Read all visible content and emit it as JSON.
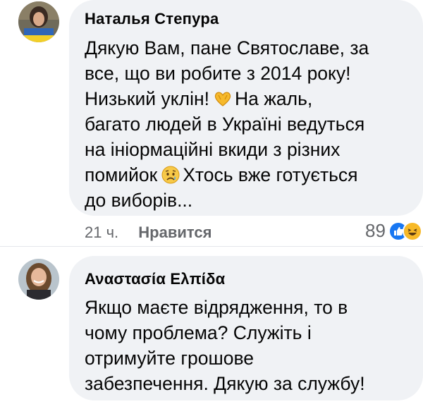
{
  "comments": [
    {
      "author": "Наталья Степура",
      "lines": [
        "Дякую Вам, пане Святославе, за",
        "все, що ви робите з 2014 року!",
        "Низький уклін!",
        "На жаль,",
        "багато людей в Україні ведуться",
        "на ініормаційні вкиди з різних",
        "помийок",
        "Хтось вже готується",
        "до виборів..."
      ],
      "emojis": [
        "heart-hands",
        "sad-face"
      ],
      "timestamp": "21 ч.",
      "like_label": "Нравится",
      "reaction_count": "89",
      "reactions": [
        "like",
        "haha"
      ],
      "colors": {
        "like": "#1877f2",
        "haha": "#f7b928"
      }
    },
    {
      "author": "Αναστασία Ελπίδα",
      "lines": [
        "Якщо маєте відрядження, то в",
        "чому проблема? Служіть і",
        "отримуйте грошове",
        "забезпечення. Дякую за службу!"
      ]
    }
  ],
  "theme": {
    "bubble": "#f0f2f5",
    "meta": "#65676b",
    "text": "#050505"
  }
}
